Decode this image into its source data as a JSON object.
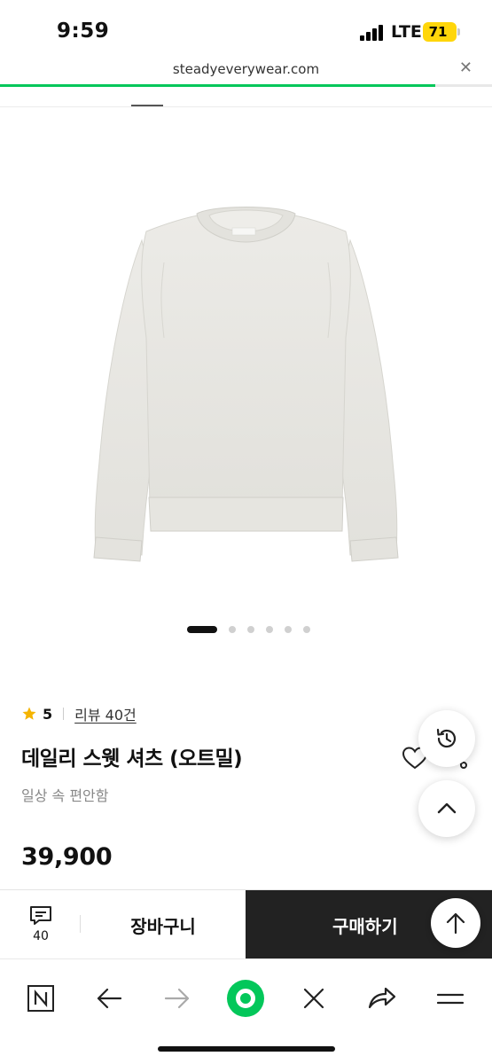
{
  "status_bar": {
    "time": "9:59",
    "network": "LTE",
    "battery": "71"
  },
  "browser": {
    "url": "steadyeverywear.com",
    "load_progress": 0.885
  },
  "product": {
    "image_count": 6,
    "active_image_index": 0,
    "rating": "5",
    "reviews_label": "리뷰 40건",
    "title": "데일리 스웻 셔츠 (오트밀)",
    "subtitle": "일상 속 편안함",
    "price": "39,900"
  },
  "purchase_bar": {
    "comment_count": "40",
    "cart_label": "장바구니",
    "buy_label": "구매하기"
  },
  "icons": {
    "star": "star-icon",
    "heart": "heart-icon",
    "share": "share-icon",
    "history": "history-icon",
    "chevron_up": "chevron-up-icon",
    "comment": "comment-icon",
    "arrow_up": "arrow-up-icon",
    "toolbar": [
      "naver-n-icon",
      "back-arrow-icon",
      "forward-arrow-icon",
      "green-home-icon",
      "close-icon",
      "share-arrow-icon",
      "menu-icon"
    ]
  },
  "colors": {
    "accent_green": "#03c75a",
    "battery_yellow": "#ffd60a",
    "star_yellow": "#f5b400",
    "buy_button": "#222222"
  }
}
